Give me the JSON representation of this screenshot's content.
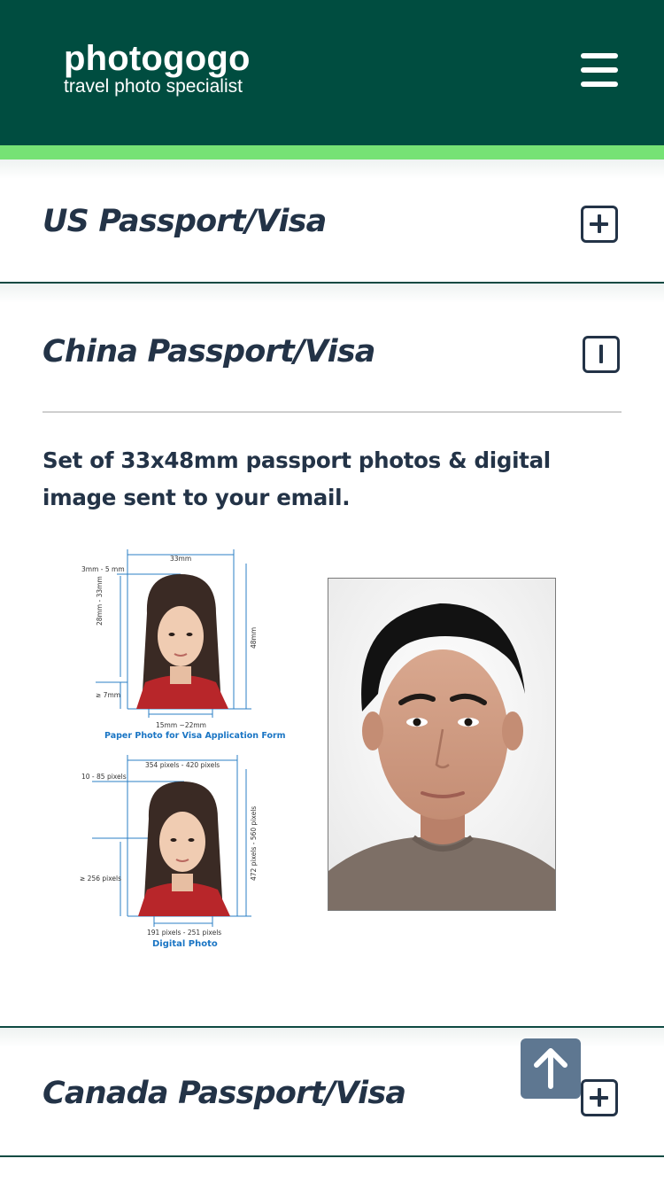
{
  "header": {
    "brand_name": "photogogo",
    "brand_tagline": "travel photo specialist",
    "menu_icon": "hamburger-menu-icon",
    "bg_color": "#004d40",
    "stripe_color": "#76e275"
  },
  "accordion": [
    {
      "title": "US Passport/Visa",
      "state": "collapsed",
      "toggle_icon": "plus-square-icon"
    },
    {
      "title": "China Passport/Visa",
      "state": "expanded",
      "toggle_icon": "minus-square-icon",
      "description": "Set of 33x48mm passport photos & digital image sent to your email.",
      "spec_figure": {
        "paper": {
          "width_label": "33mm",
          "top_label": "3mm - 5 mm",
          "face_label": "28mm - 33mm",
          "height_label": "48mm",
          "chin_label": "≥ 7mm",
          "face_width_label": "15mm ~22mm",
          "caption": "Paper Photo for Visa Application Form"
        },
        "digital": {
          "width_label": "354 pixels - 420 pixels",
          "top_label": "10 - 85 pixels",
          "height_label": "472 pixels - 560 pixels",
          "chin_label": "≥ 256 pixels",
          "face_width_label": "191 pixels - 251 pixels",
          "caption": "Digital Photo"
        }
      }
    },
    {
      "title": "Canada Passport/Visa",
      "state": "collapsed",
      "toggle_icon": "plus-square-icon"
    }
  ],
  "back_to_top_icon": "arrow-up-icon",
  "colors": {
    "heading": "#233347",
    "accent_blue": "#1a75c4",
    "back_top_bg": "#5e7791"
  }
}
